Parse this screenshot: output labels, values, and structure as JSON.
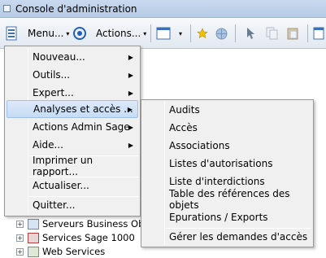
{
  "window": {
    "title": "Console d'administration"
  },
  "toolbar": {
    "menu_label": "Menu...",
    "actions_label": "Actions...",
    "arrow": "▾"
  },
  "icons": {
    "console_icon": "window-icon",
    "target_icon": "target-icon",
    "view_icon": "view-icon",
    "star_icon": "star-icon",
    "globe_icon": "globe-icon",
    "pointer_icon": "pointer-icon",
    "copy_icon": "copy-icon",
    "paste_icon": "paste-icon"
  },
  "main_menu": {
    "items": [
      {
        "label": "Nouveau...",
        "submenu": true
      },
      {
        "label": "Outils...",
        "submenu": true
      },
      {
        "label": "Expert...",
        "submenu": true
      },
      {
        "label": "Analyses et accès ...",
        "submenu": true,
        "highlighted": true
      },
      {
        "label": "Actions Admin Sage",
        "submenu": true
      },
      {
        "label": "Aide...",
        "submenu": true
      },
      {
        "label": "Imprimer un rapport...",
        "submenu": false
      },
      {
        "label": "Actualiser...",
        "submenu": false
      },
      {
        "label": "Quitter...",
        "submenu": false
      }
    ],
    "submenu_arrow": "▶"
  },
  "sub_menu": {
    "items": [
      {
        "label": "Audits"
      },
      {
        "label": "Accès"
      },
      {
        "label": "Associations"
      },
      {
        "label": "Listes d'autorisations"
      },
      {
        "label": "Liste d'interdictions"
      },
      {
        "label": "Table des références des objets"
      },
      {
        "label": "Epurations / Exports"
      },
      {
        "label": "Gérer les demandes d'accès"
      }
    ]
  },
  "tree": {
    "expander": "+",
    "items": [
      {
        "label": "Serveurs Business Objec"
      },
      {
        "label": "Services Sage 1000"
      },
      {
        "label": "Web Services"
      }
    ]
  },
  "colors": {
    "highlight": "#c6dcf5",
    "menu_bg": "#f0f0f0",
    "accent_blue": "#1f5fbf"
  }
}
